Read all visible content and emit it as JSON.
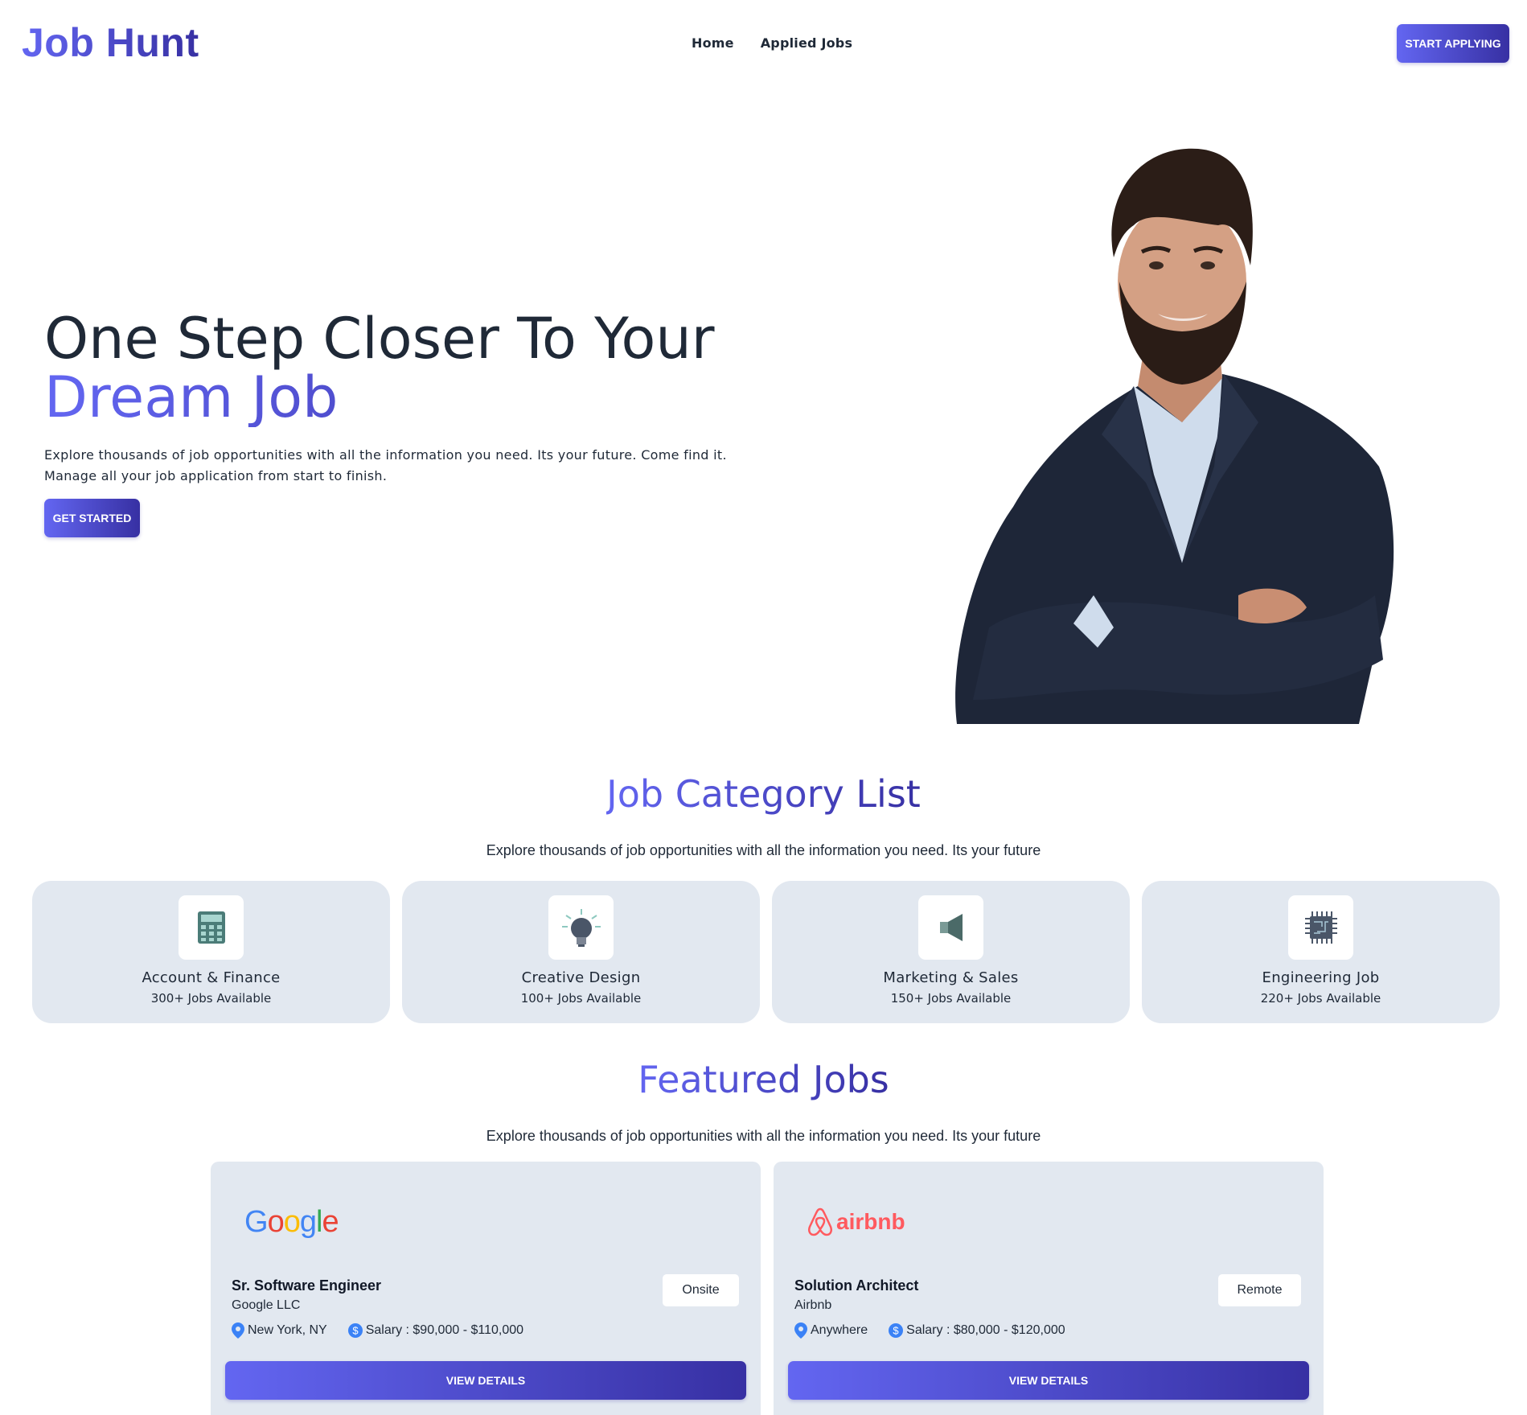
{
  "nav": {
    "logo": "Job Hunt",
    "links": [
      "Home",
      "Applied Jobs"
    ],
    "cta": "START APPLYING"
  },
  "hero": {
    "title_line1": "One Step Closer To Your",
    "title_line2": "Dream Job",
    "description_line1": "Explore thousands of job opportunities with all the information you need. Its your future. Come find it.",
    "description_line2": "Manage all your job application from start to finish.",
    "button": "GET STARTED"
  },
  "categories": {
    "title": "Job Category List",
    "subtitle": "Explore thousands of job opportunities with all the information you need. Its your future",
    "items": [
      {
        "name": "Account & Finance",
        "count": "300+ Jobs Available",
        "icon": "calculator-icon"
      },
      {
        "name": "Creative Design",
        "count": "100+ Jobs Available",
        "icon": "lightbulb-icon"
      },
      {
        "name": "Marketing & Sales",
        "count": "150+ Jobs Available",
        "icon": "megaphone-icon"
      },
      {
        "name": "Engineering Job",
        "count": "220+ Jobs Available",
        "icon": "chip-icon"
      }
    ]
  },
  "featured": {
    "title": "Featured Jobs",
    "subtitle": "Explore thousands of job opportunities with all the information you need. Its your future",
    "jobs": [
      {
        "logo": "Google",
        "title": "Sr. Software Engineer",
        "company": "Google LLC",
        "type": "Onsite",
        "location": "New York, NY",
        "salary": "Salary : $90,000 - $110,000",
        "button": "VIEW DETAILS"
      },
      {
        "logo": "airbnb",
        "title": "Solution Architect",
        "company": "Airbnb",
        "type": "Remote",
        "location": "Anywhere",
        "salary": "Salary : $80,000 - $120,000",
        "button": "VIEW DETAILS"
      }
    ]
  },
  "colors": {
    "accent_start": "#6366f1",
    "accent_end": "#3730a3",
    "card_bg": "#e2e8f0",
    "text": "#1f2937"
  }
}
